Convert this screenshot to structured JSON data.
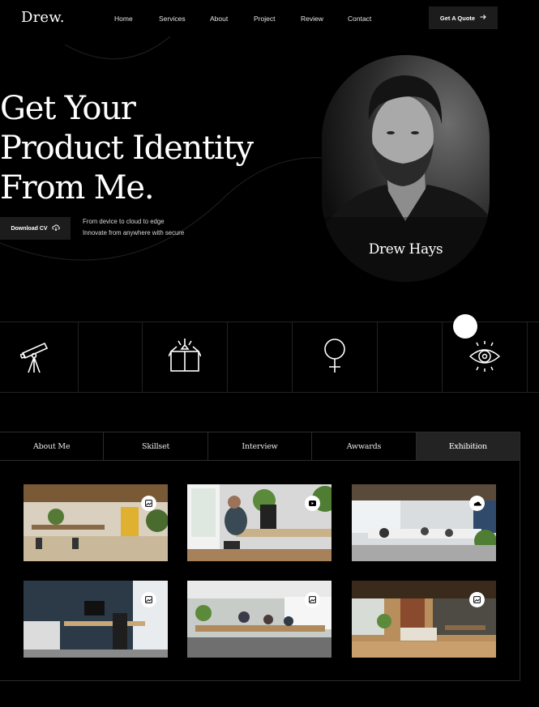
{
  "brand": {
    "logo": "Drew."
  },
  "nav": {
    "items": [
      "Home",
      "Services",
      "About",
      "Project",
      "Review",
      "Contact"
    ],
    "cta_label": "Get A Quote"
  },
  "hero": {
    "title_lines": [
      "Get Your",
      "Product Identity",
      "From Me."
    ],
    "download_label": "Download CV",
    "tagline_lines": [
      "From device to cloud to edge",
      "Innovate from anywhere with secure"
    ],
    "portrait_name": "Drew Hays"
  },
  "services_strip": {
    "icons": [
      "telescope-icon",
      "gift-box-icon",
      "female-symbol-icon",
      "eye-icon"
    ]
  },
  "tabs": {
    "items": [
      "About Me",
      "Skillset",
      "Interview",
      "Awwards",
      "Exhibition"
    ],
    "active": "Exhibition"
  },
  "gallery": {
    "badges": [
      "image-icon",
      "youtube-icon",
      "soundcloud-icon",
      "image-icon",
      "image-icon",
      "image-icon"
    ]
  },
  "colors": {
    "background": "#000000",
    "button": "#1c1c1c",
    "active_tab": "#232323",
    "text": "#ffffff"
  }
}
